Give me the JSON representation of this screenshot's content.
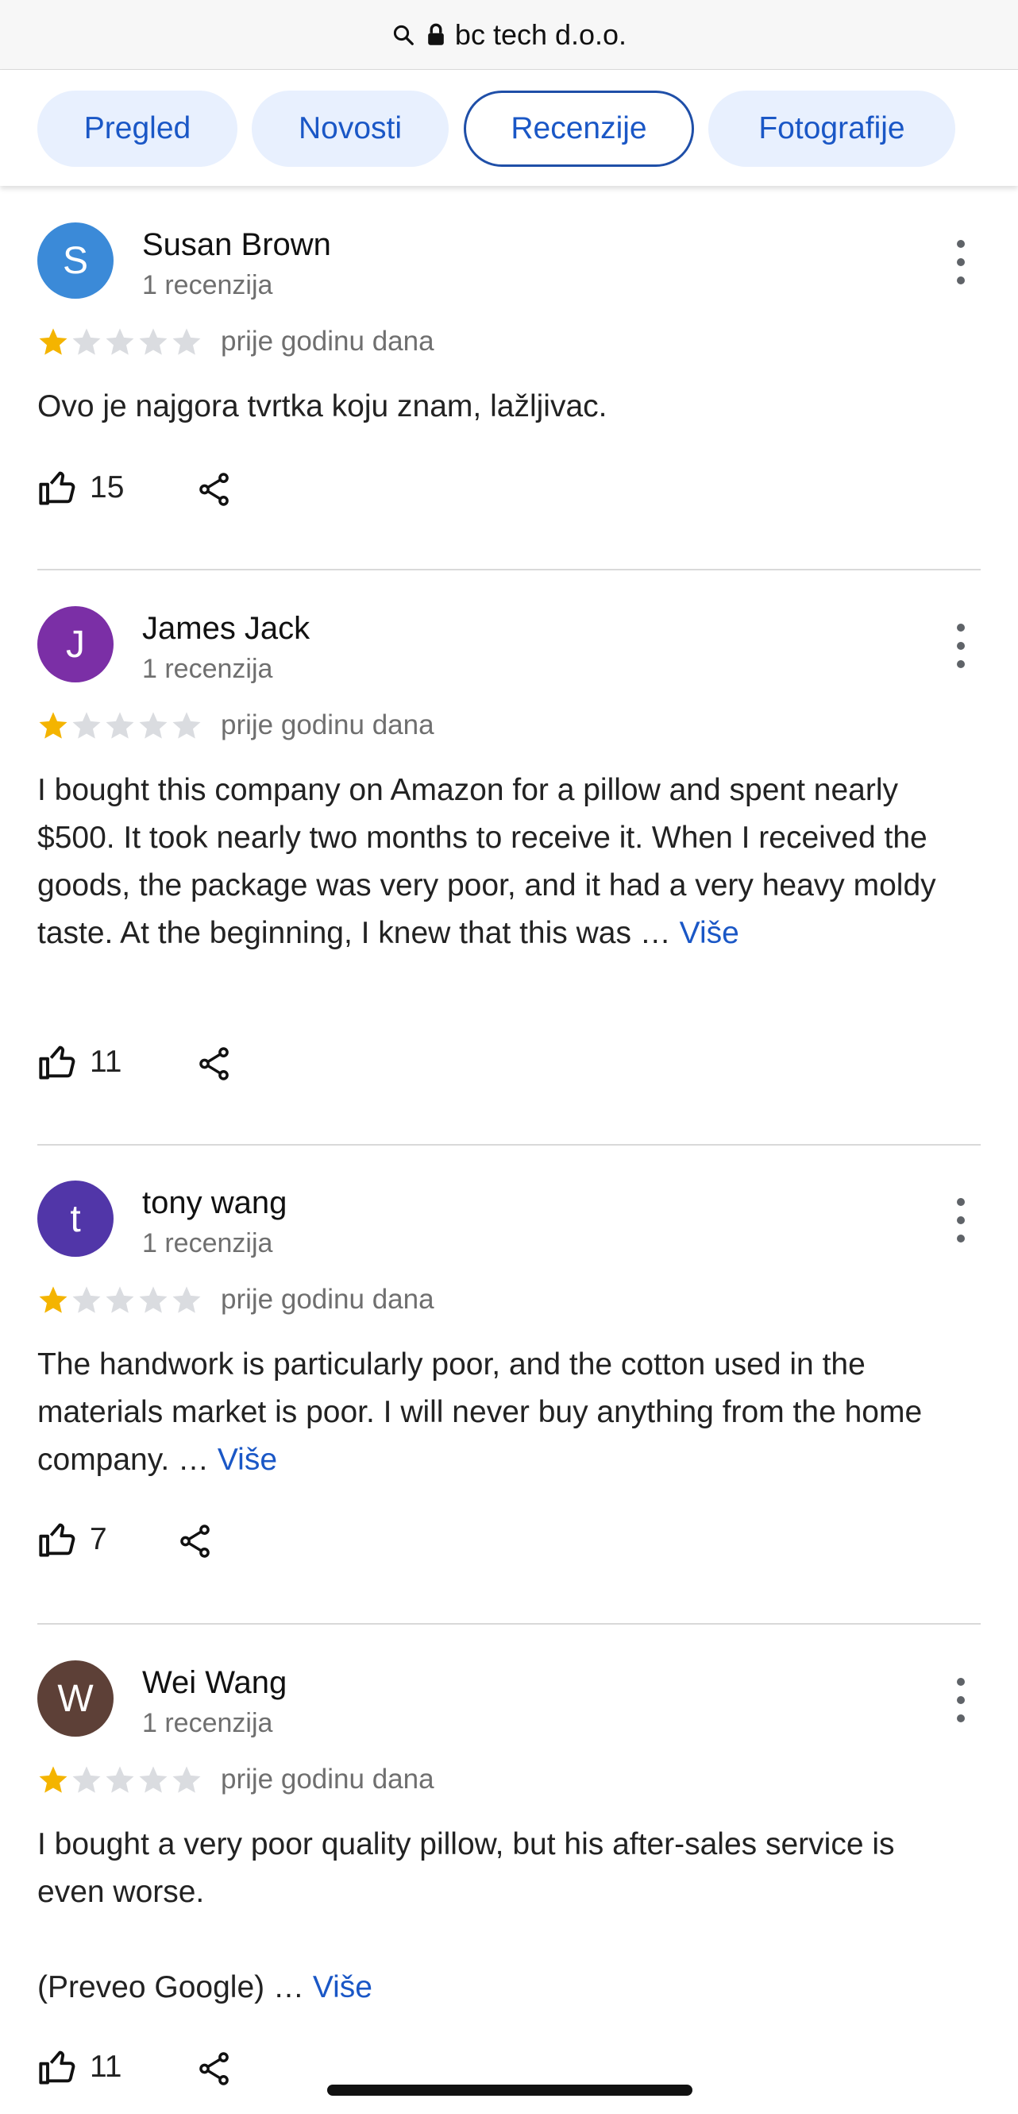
{
  "url_bar": {
    "domain": "bc tech d.o.o.",
    "icons": [
      "search-icon",
      "lock-icon"
    ]
  },
  "tabs": [
    {
      "label": "Pregled",
      "active": false
    },
    {
      "label": "Novosti",
      "active": false
    },
    {
      "label": "Recenzije",
      "active": true
    },
    {
      "label": "Fotografije",
      "active": false
    }
  ],
  "colors": {
    "accent": "#1a57c6",
    "tab_bg": "#e8f0fe",
    "star_filled": "#f4b400",
    "star_empty": "#dadce0"
  },
  "reviews": [
    {
      "initial": "S",
      "avatar_color": "#3b8ad8",
      "name": "Susan Brown",
      "count": "1 recenzija",
      "rating": 1,
      "time": "prije godinu dana",
      "text": "Ovo je najgora tvrtka koju znam, lažljivac.",
      "more": "",
      "likes": "15"
    },
    {
      "initial": "J",
      "avatar_color": "#7b2fa6",
      "name": "James Jack",
      "count": "1 recenzija",
      "rating": 1,
      "time": "prije godinu dana",
      "text": "I bought this company on Amazon for a pillow and spent nearly $500. It took nearly two months to receive it. When I received the goods, the package was very poor, and it had a very heavy moldy taste. At the beginning, I knew that this was …",
      "more": "Više",
      "likes": "11"
    },
    {
      "initial": "t",
      "avatar_color": "#5136a8",
      "name": "tony wang",
      "count": "1 recenzija",
      "rating": 1,
      "time": "prije godinu dana",
      "text": "The handwork is particularly poor, and the cotton used in the materials market is poor. I will never buy anything from the home company. …",
      "more": "Više",
      "likes": "7"
    },
    {
      "initial": "W",
      "avatar_color": "#5d4037",
      "name": "Wei Wang",
      "count": "1 recenzija",
      "rating": 1,
      "time": "prije godinu dana",
      "text": "I bought a very poor quality pillow, but his after-sales service is even worse.",
      "text2": "(Preveo Google) …",
      "more": "Više",
      "likes": "11"
    }
  ]
}
